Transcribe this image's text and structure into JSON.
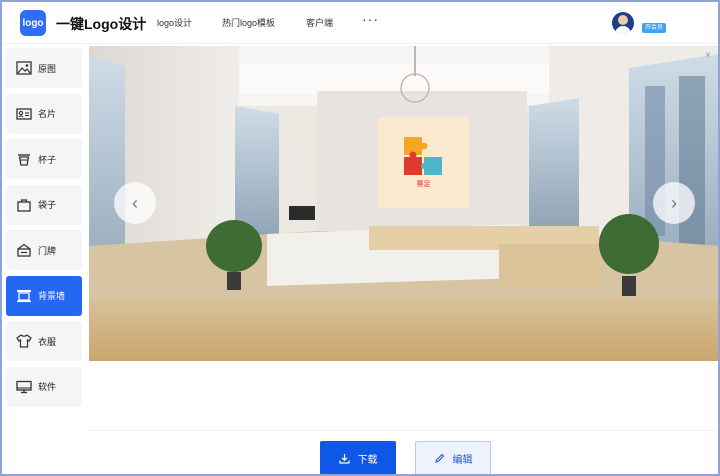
{
  "header": {
    "logo_mark": "logo",
    "brand": "一键Logo设计",
    "nav": [
      "logo设计",
      "热门logo模板",
      "客户端"
    ],
    "more": "···",
    "member_badge": "开会员"
  },
  "sidebar": {
    "items": [
      {
        "label": "原图",
        "icon": "image-icon",
        "active": false
      },
      {
        "label": "名片",
        "icon": "card-icon",
        "active": false
      },
      {
        "label": "杯子",
        "icon": "cup-icon",
        "active": false
      },
      {
        "label": "袋子",
        "icon": "bag-icon",
        "active": false
      },
      {
        "label": "门牌",
        "icon": "sign-icon",
        "active": false
      },
      {
        "label": "背景墙",
        "icon": "wall-icon",
        "active": true
      },
      {
        "label": "衣服",
        "icon": "shirt-icon",
        "active": false
      },
      {
        "label": "软件",
        "icon": "monitor-icon",
        "active": false
      }
    ]
  },
  "preview": {
    "logo_text": "赛足",
    "prev_label": "‹",
    "next_label": "›",
    "close_label": "×"
  },
  "actions": {
    "download": "下载",
    "edit": "编辑"
  },
  "colors": {
    "accent": "#2367f2",
    "download": "#0f57e8",
    "frame": "#8fa3d6"
  }
}
